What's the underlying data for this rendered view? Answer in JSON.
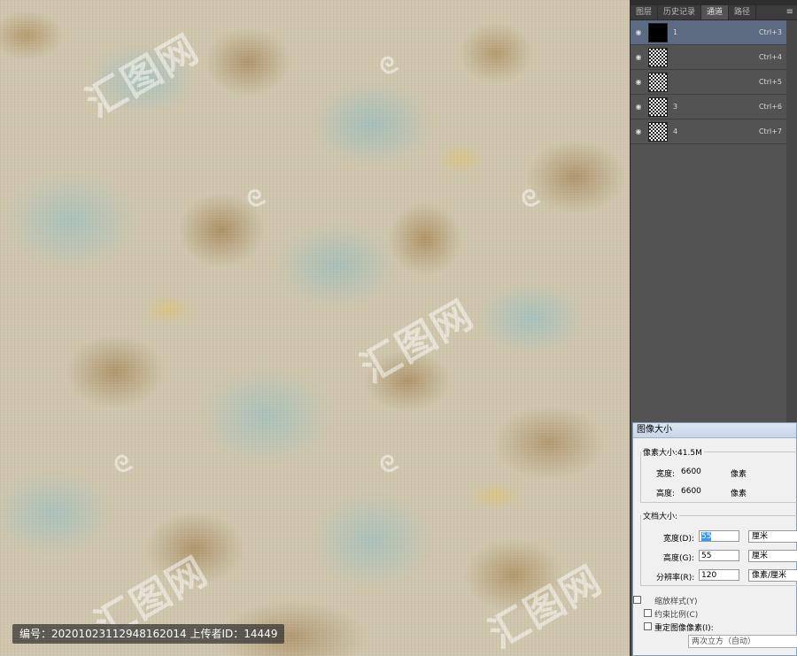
{
  "canvas": {
    "watermark_text": "汇图网",
    "watermark_logo": "ᘓ"
  },
  "upload_info": "编号：20201023112948162014 上传者ID：14449",
  "panel": {
    "tabs": [
      {
        "label": "图层",
        "active": false
      },
      {
        "label": "历史记录",
        "active": false
      },
      {
        "label": "通道",
        "active": true
      },
      {
        "label": "路径",
        "active": false
      }
    ],
    "menu_icon": "≡",
    "channels": [
      {
        "name": "1",
        "shortcut": "Ctrl+3",
        "thumb": "black",
        "selected": true
      },
      {
        "name": "",
        "shortcut": "Ctrl+4",
        "thumb": "texture",
        "selected": false
      },
      {
        "name": "",
        "shortcut": "Ctrl+5",
        "thumb": "texture",
        "selected": false
      },
      {
        "name": "3",
        "shortcut": "Ctrl+6",
        "thumb": "texture",
        "selected": false
      },
      {
        "name": "4",
        "shortcut": "Ctrl+7",
        "thumb": "texture",
        "selected": false
      }
    ]
  },
  "dialog": {
    "title": "图像大小",
    "pixel_dimensions_legend": "像素大小:41.5M",
    "width_label": "宽度:",
    "width_value": "6600",
    "width_unit": "像素",
    "height_label": "高度:",
    "height_value": "6600",
    "height_unit": "像素",
    "doc_size_legend": "文档大小:",
    "doc_width_label": "宽度(D):",
    "doc_width_value": "55",
    "doc_width_unit": "厘米",
    "doc_height_label": "高度(G):",
    "doc_height_value": "55",
    "doc_height_unit": "厘米",
    "resolution_label": "分辨率(R):",
    "resolution_value": "120",
    "resolution_unit": "像素/厘米",
    "scale_styles_label": "缩放样式(Y)",
    "constrain_label": "约束比例(C)",
    "resample_label": "重定图像像素(I):",
    "resample_method": "两次立方（自动）"
  }
}
